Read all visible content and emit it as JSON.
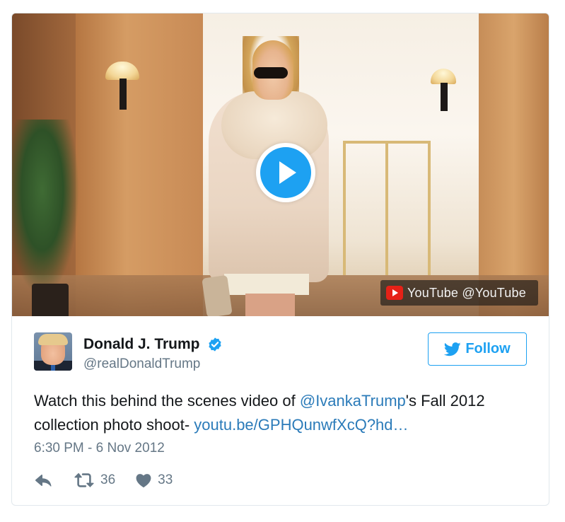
{
  "media": {
    "youtube_label": "YouTube @YouTube",
    "play_icon": "play-icon",
    "youtube_icon": "youtube-logo-icon"
  },
  "author": {
    "display_name": "Donald J. Trump",
    "handle": "@realDonaldTrump",
    "verified_icon": "verified-badge-icon"
  },
  "follow": {
    "label": "Follow",
    "icon": "twitter-bird-icon"
  },
  "tweet": {
    "text_before": "Watch this behind the scenes video of ",
    "mention": "@IvankaTrump",
    "text_middle": "'s Fall 2012 collection photo shoot- ",
    "link": "youtu.be/GPHQunwfXcQ?hd…",
    "timestamp": "6:30 PM - 6 Nov 2012"
  },
  "actions": {
    "reply_icon": "reply-icon",
    "retweet_icon": "retweet-icon",
    "retweet_count": "36",
    "like_icon": "heart-icon",
    "like_count": "33"
  },
  "colors": {
    "accent": "#1da1f2",
    "link": "#2b7bb9",
    "secondary_text": "#657786",
    "border": "#e1e8ed"
  }
}
